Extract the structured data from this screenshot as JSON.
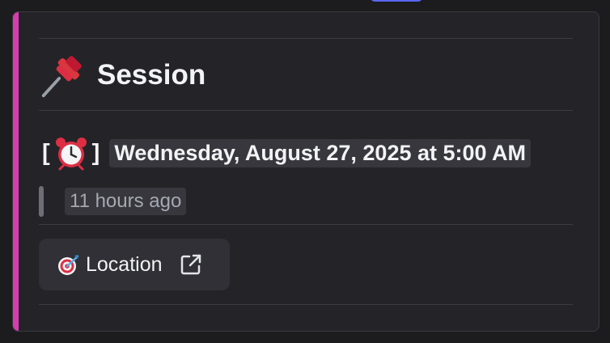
{
  "embed": {
    "accent_color": "#d63db0",
    "title": "Session",
    "title_icon": "pushpin-icon",
    "date": {
      "bracket_open": "[",
      "icon": "alarm-clock-icon",
      "bracket_close": "]",
      "timestamp": "Wednesday, August 27, 2025 at 5:00 AM"
    },
    "relative_time": "11 hours ago",
    "location_button": {
      "icon": "direct-hit-icon",
      "label": "Location",
      "trailing_icon": "external-link-icon"
    }
  }
}
